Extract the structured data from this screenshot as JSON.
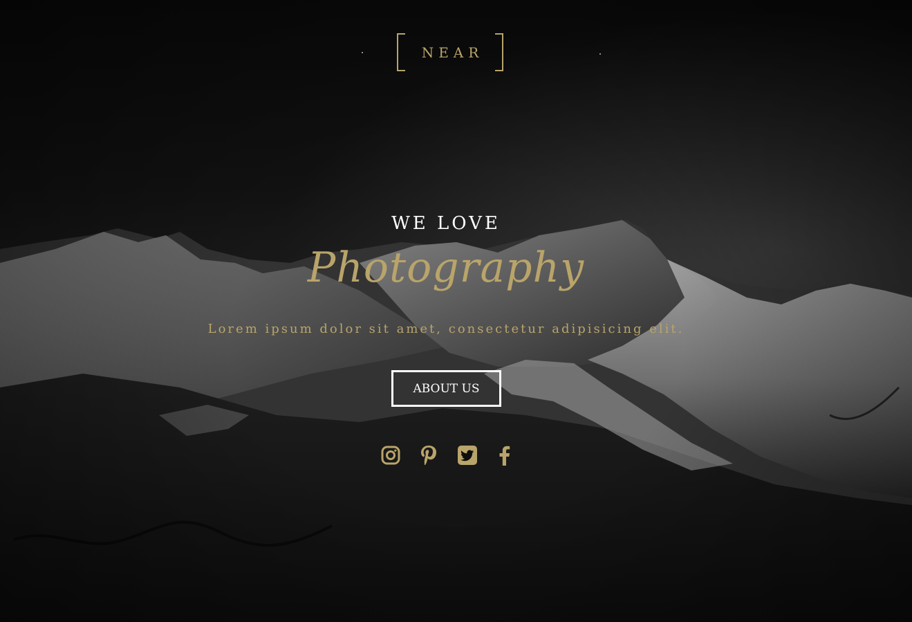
{
  "brand": {
    "logo_text": "NEAR"
  },
  "hero": {
    "eyebrow": "WE LOVE",
    "headline": "Photography",
    "lead": "Lorem ipsum dolor sit amet, consectetur adipisicing elit.",
    "cta_label": "ABOUT US"
  },
  "social": [
    {
      "icon": "instagram-icon"
    },
    {
      "icon": "pinterest-icon"
    },
    {
      "icon": "twitter-icon"
    },
    {
      "icon": "facebook-icon"
    }
  ],
  "colors": {
    "accent": "#b9a46a",
    "text": "#ffffff",
    "background": "#0e0e0e"
  }
}
